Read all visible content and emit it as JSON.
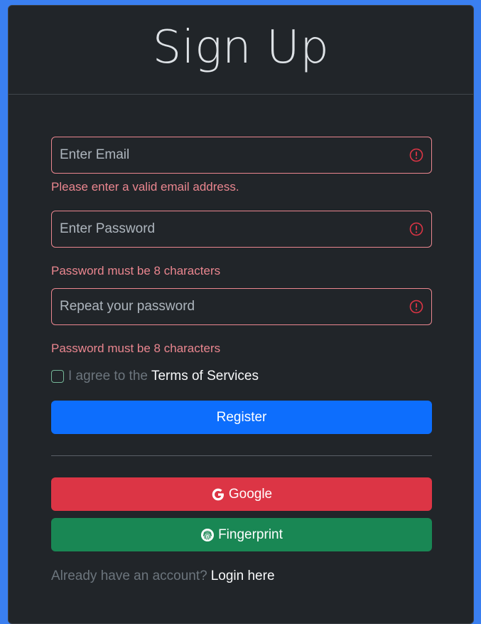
{
  "header": {
    "title": "Sign Up"
  },
  "form": {
    "email": {
      "placeholder": "Enter Email",
      "error": "Please enter a valid email address."
    },
    "password": {
      "placeholder": "Enter Password",
      "error": "Password must be 8 characters"
    },
    "repeat_password": {
      "placeholder": "Repeat your password",
      "error": "Password must be 8 characters"
    },
    "terms": {
      "prefix": "I agree to the",
      "link": "Terms of Services",
      "checked": false
    },
    "register_label": "Register"
  },
  "social": {
    "google_label": "Google",
    "fingerprint_label": "Fingerprint"
  },
  "footer": {
    "prompt": "Already have an account?",
    "login_link": "Login here"
  },
  "colors": {
    "background": "#3a7ff0",
    "card": "#212529",
    "error": "#ea868f",
    "primary": "#0d6efd",
    "danger": "#dc3545",
    "success": "#198754"
  },
  "icons": {
    "error": "exclamation-circle-icon",
    "google": "google-g-icon",
    "fingerprint": "fingerprint-icon"
  }
}
